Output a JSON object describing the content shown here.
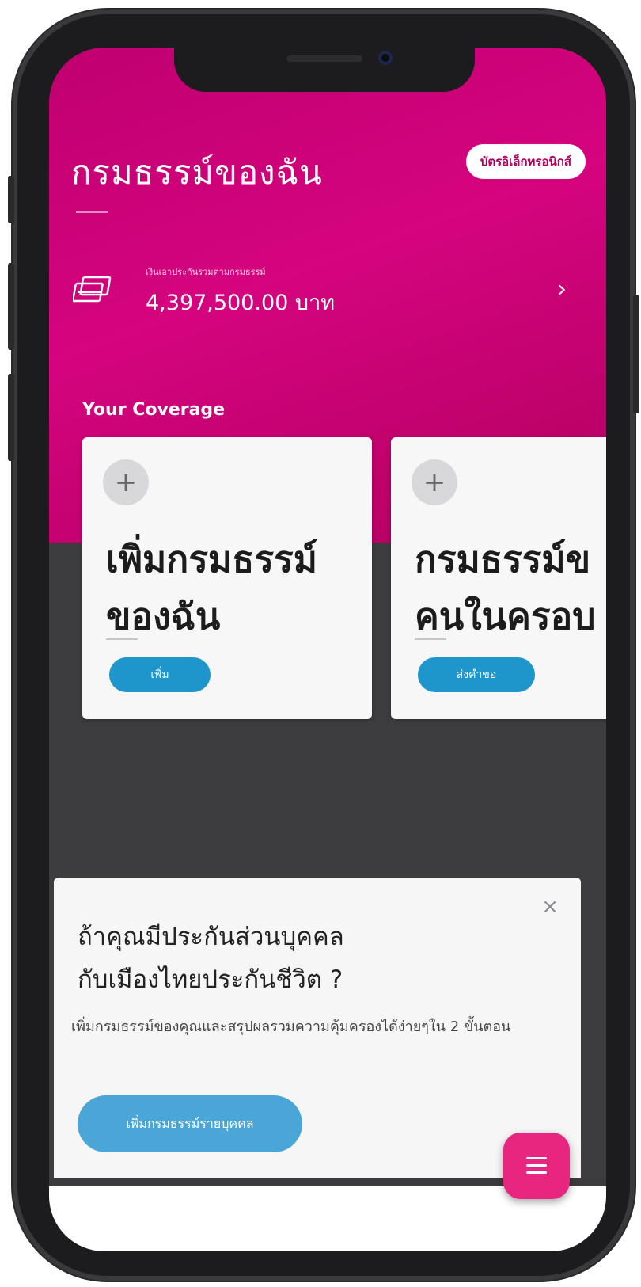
{
  "header": {
    "title": "กรมธรรม์ของฉัน",
    "ecard_button": "บัตรอิเล็กทรอนิกส์"
  },
  "sum_insured": {
    "caption": "เงินเอาประกันรวมตามกรมธรรม์",
    "value": "4,397,500.00 บาท",
    "chevron": "›"
  },
  "coverage": {
    "label": "Your Coverage",
    "cards": [
      {
        "plus": "+",
        "title_line1": "เพิ่มกรมธรรม์",
        "title_line2": "ของฉัน",
        "button": "เพิ่ม"
      },
      {
        "plus": "+",
        "title_line1": "กรมธรรม์ข",
        "title_line2": "คนในครอบ",
        "button": "ส่งคำขอ"
      }
    ]
  },
  "sheet": {
    "close": "×",
    "title_line1": "ถ้าคุณมีประกันส่วนบุคคล",
    "title_line2": "กับเมืองไทยประกันชีวิต ?",
    "body": "เพิ่มกรมธรรม์ของคุณและสรุปผลรวมความคุ้มครองได้ง่ายๆใน 2 ขั้นตอน",
    "button": "เพิ่มกรมธรรม์รายบุคคล"
  },
  "colors": {
    "brand_magenta": "#d5047f",
    "button_blue": "#1e95cb",
    "fab_pink": "#e8257f"
  }
}
